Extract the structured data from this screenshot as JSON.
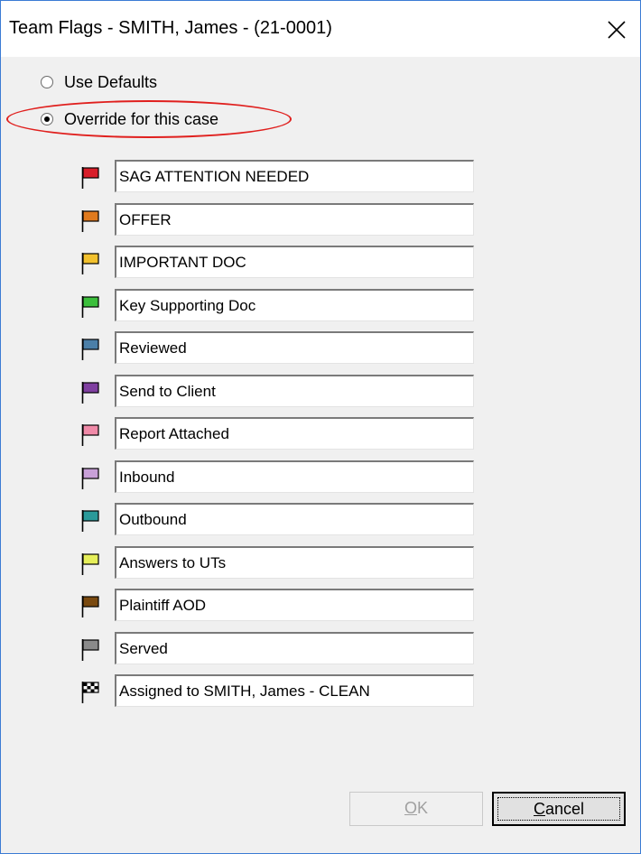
{
  "window": {
    "title": "Team Flags - SMITH, James - (21-0001)"
  },
  "options": {
    "use_defaults": "Use Defaults",
    "override": "Override for this case",
    "selected": "override"
  },
  "flags": [
    {
      "label": "SAG ATTENTION NEEDED",
      "color": "#d81e2a"
    },
    {
      "label": "OFFER",
      "color": "#e07a1e"
    },
    {
      "label": "IMPORTANT DOC",
      "color": "#f2c12e"
    },
    {
      "label": "Key Supporting Doc",
      "color": "#3cbf3c"
    },
    {
      "label": "Reviewed",
      "color": "#4b7fa8"
    },
    {
      "label": "Send to Client",
      "color": "#7f3fa0"
    },
    {
      "label": "Report Attached",
      "color": "#f08aa8"
    },
    {
      "label": "Inbound",
      "color": "#c8a0d8"
    },
    {
      "label": "Outbound",
      "color": "#2a9a9a"
    },
    {
      "label": "Answers to UTs",
      "color": "#e6ef5a"
    },
    {
      "label": "Plaintiff AOD",
      "color": "#7a4a10"
    },
    {
      "label": "Served",
      "color": "#8a8a8a"
    },
    {
      "label": "Assigned to SMITH, James - CLEAN",
      "color": "checkered"
    }
  ],
  "buttons": {
    "ok_mnemonic": "O",
    "ok_rest": "K",
    "cancel_mnemonic": "C",
    "cancel_rest": "ancel"
  }
}
